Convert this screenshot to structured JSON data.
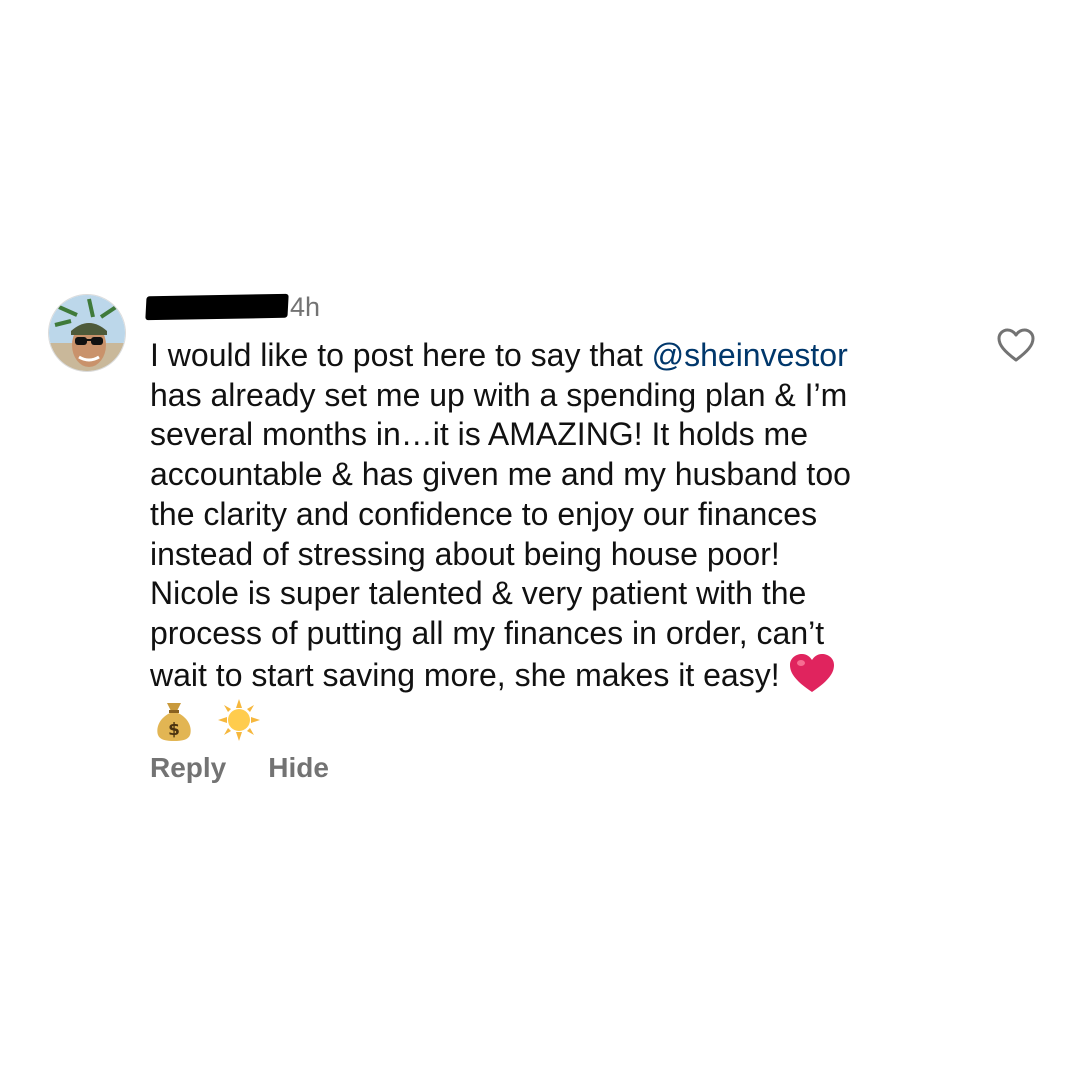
{
  "comment": {
    "timestamp": "4h",
    "text_before_mention": "I would like to post here to say that ",
    "mention": "@sheinvestor",
    "text_after_mention": "\nhas already set me up with a spending plan & I’m\nseveral months in…it is AMAZING! It holds me\naccountable & has given me and my husband too\nthe clarity and confidence to enjoy our finances\ninstead of stressing about being house poor!\nNicole is super talented & very patient with the\nprocess of putting all my finances in order, can’t\nwait to start saving more, she makes it easy!",
    "emoji_inline": "red-heart-emoji",
    "emoji_line": [
      "money-bag-emoji",
      "sun-emoji"
    ]
  },
  "actions": {
    "reply_label": "Reply",
    "hide_label": "Hide"
  },
  "icons": {
    "like": "heart-outline-icon"
  },
  "colors": {
    "mention": "#00376b",
    "muted": "#737373",
    "heart_red": "#e0245e"
  }
}
